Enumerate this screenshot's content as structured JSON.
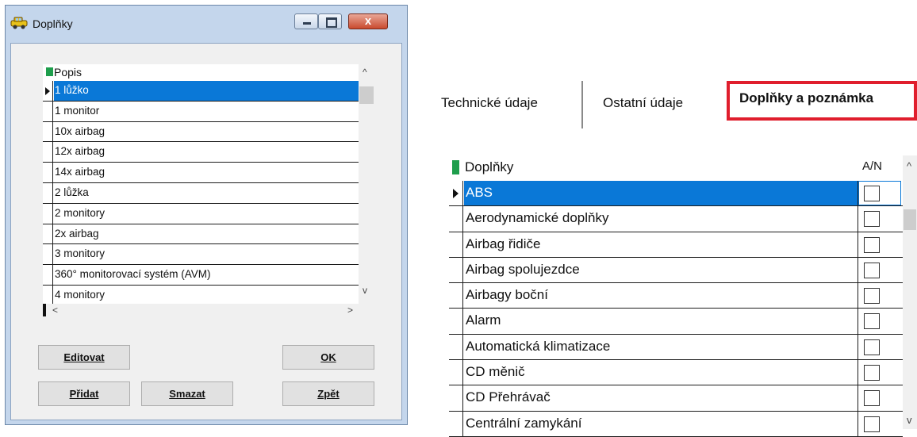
{
  "dialog": {
    "title": "Doplňky",
    "list": {
      "column_header": "Popis",
      "selected_index": 0,
      "rows": [
        "1 lůžko",
        "1 monitor",
        "10x airbag",
        "12x airbag",
        "14x airbag",
        "2 lůžka",
        "2 monitory",
        "2x airbag",
        "3 monitory",
        "360° monitorovací systém (AVM)",
        "4 monitory"
      ],
      "scroll_up": "^",
      "scroll_down": "v",
      "scroll_left": "<",
      "scroll_right": ">"
    },
    "buttons": {
      "edit": "Editovat",
      "ok": "OK",
      "add": "Přidat",
      "delete": "Smazat",
      "back": "Zpět"
    },
    "close_glyph": "x"
  },
  "panel": {
    "tabs": [
      "Technické údaje",
      "Ostatní údaje",
      "Doplňky a poznámka"
    ],
    "active_tab": "Doplňky a poznámka",
    "highlight_color": "#e01e2d",
    "grid": {
      "column_header": "Doplňky",
      "an_header": "A/N",
      "selected_index": 0,
      "rows": [
        {
          "label": "ABS",
          "checked": false
        },
        {
          "label": "Aerodynamické doplňky",
          "checked": false
        },
        {
          "label": "Airbag řidiče",
          "checked": false
        },
        {
          "label": "Airbag spolujezdce",
          "checked": false
        },
        {
          "label": "Airbagy boční",
          "checked": false
        },
        {
          "label": "Alarm",
          "checked": false
        },
        {
          "label": "Automatická klimatizace",
          "checked": false
        },
        {
          "label": "CD měnič",
          "checked": false
        },
        {
          "label": "CD Přehrávač",
          "checked": false
        },
        {
          "label": "Centrální zamykání",
          "checked": false
        }
      ],
      "scroll_up": "^",
      "scroll_down": "v"
    }
  },
  "colors": {
    "selection": "#0a78d7",
    "indicator": "#1e9e4c"
  }
}
